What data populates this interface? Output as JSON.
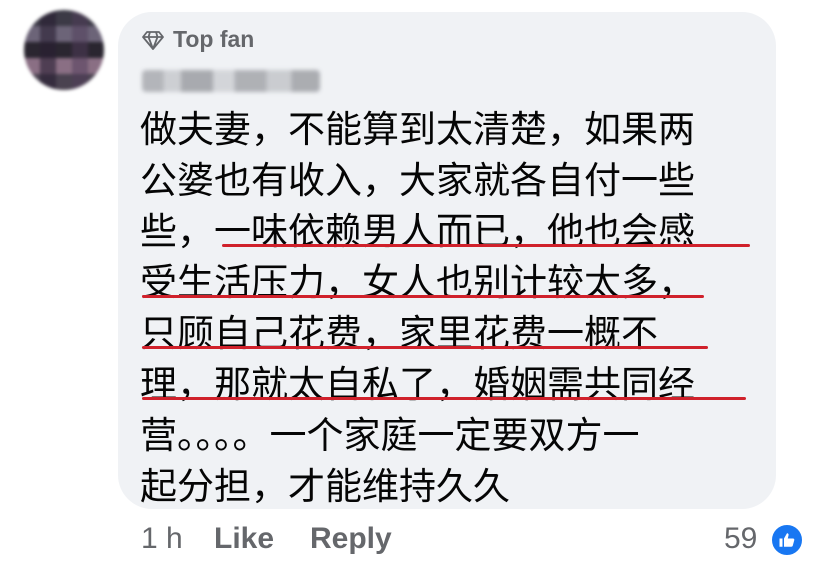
{
  "comment": {
    "badge_label": "Top fan",
    "lines": [
      "做夫妻，不能算到太清楚，如果两",
      "公婆也有收入，大家就各自付一些",
      "些，一味依赖男人而已，他也会感",
      "受生活压力，女人也别计较太多，",
      "只顾自己花费，家里花费一概不",
      "理，那就太自私了，婚姻需共同经",
      "营。。。。一个家庭一定要双方一",
      "起分担，才能维持久久"
    ],
    "underline_color": "#d0212b"
  },
  "footer": {
    "time": "1 h",
    "like_label": "Like",
    "reply_label": "Reply",
    "reaction_count": "59",
    "reaction_icon": "thumbs-up-icon"
  },
  "colors": {
    "bubble": "#f0f2f5",
    "meta_text": "#65676b",
    "reaction": "#1877f2"
  }
}
